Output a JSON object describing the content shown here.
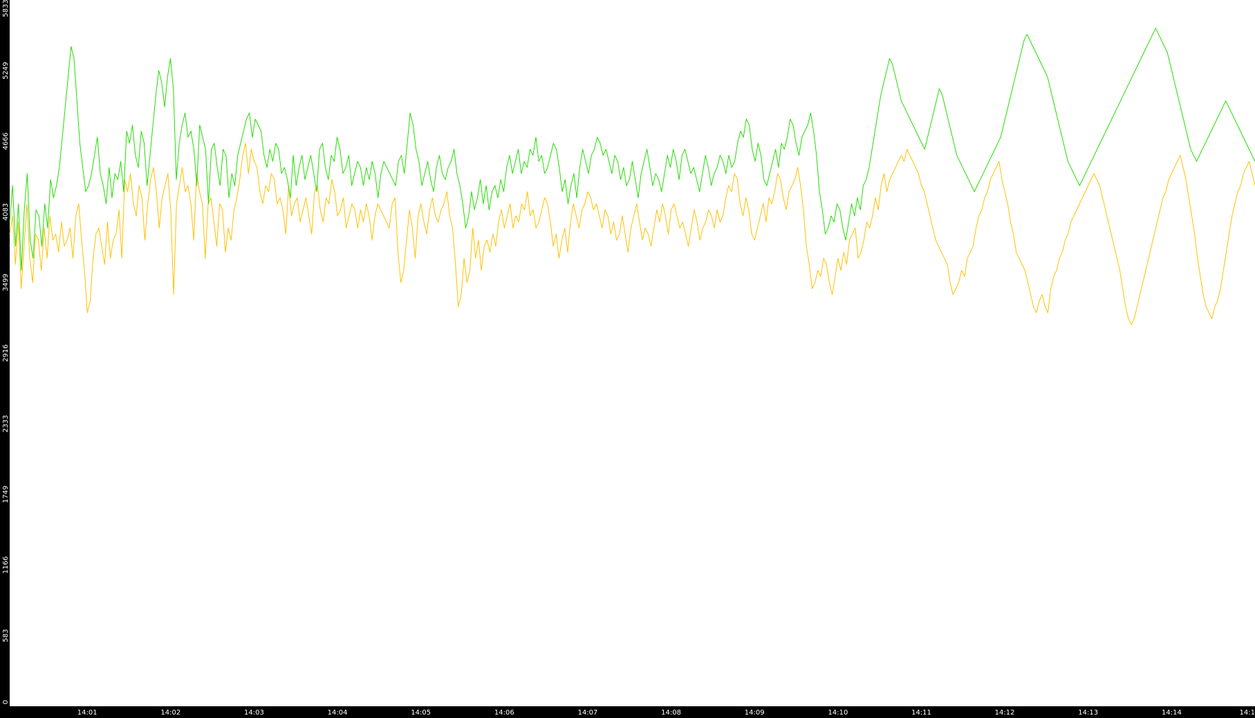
{
  "chart_data": {
    "type": "line",
    "title": "",
    "xlabel": "",
    "ylabel": "",
    "ylim": [
      0,
      5833
    ],
    "y_ticks": [
      "0",
      "583",
      "1166",
      "1749",
      "2333",
      "2916",
      "3499",
      "4083",
      "4666",
      "5249",
      "5833"
    ],
    "x_ticks": [
      "14:01",
      "14:02",
      "14:03",
      "14:04",
      "14:05",
      "14:06",
      "14:07",
      "14:08",
      "14:09",
      "14:10",
      "14:11",
      "14:12",
      "14:13",
      "14:14",
      "14:1"
    ],
    "x_tick_minutes": [
      1,
      2,
      3,
      4,
      5,
      6,
      7,
      8,
      9,
      10,
      11,
      12,
      13,
      14,
      15
    ],
    "x_start_minute": 0.07,
    "x_end_minute": 15.0,
    "grid": false,
    "legend": "none",
    "background": "#ffffff",
    "axis_background": "#000000",
    "axis_text_color": "#ffffff",
    "series": [
      {
        "color": "#ffc000",
        "values": [
          3900,
          4050,
          3650,
          4000,
          3450,
          3800,
          4150,
          3700,
          3500,
          3900,
          3850,
          3600,
          3950,
          3700,
          4050,
          3850,
          3900,
          3750,
          4000,
          3800,
          3850,
          3950,
          3700,
          4050,
          4150,
          3850,
          3600,
          3250,
          3350,
          3700,
          3900,
          3950,
          3800,
          3650,
          4000,
          3700,
          3850,
          3900,
          4100,
          3700,
          4350,
          4250,
          4400,
          4150,
          4050,
          4300,
          4200,
          3850,
          4150,
          4350,
          4450,
          4250,
          3950,
          4200,
          4300,
          4400,
          4100,
          3400,
          4150,
          4300,
          4450,
          4250,
          4300,
          4150,
          3850,
          4400,
          4250,
          4150,
          3700,
          4150,
          4200,
          4000,
          3800,
          4150,
          4100,
          3750,
          3950,
          3850,
          4100,
          4200,
          4350,
          4550,
          4650,
          4400,
          4600,
          4500,
          4450,
          4250,
          4150,
          4300,
          4250,
          4400,
          4350,
          4150,
          4200,
          4100,
          3900,
          4300,
          4050,
          4150,
          4200,
          4000,
          4100,
          4200,
          4050,
          3900,
          4250,
          4300,
          4100,
          4000,
          4200,
          4150,
          4350,
          4250,
          4050,
          4100,
          4200,
          3950,
          4050,
          4150,
          4100,
          3950,
          4100,
          4000,
          4150,
          4050,
          3850,
          4050,
          4150,
          4100,
          4050,
          4000,
          3950,
          4150,
          4200,
          3750,
          3500,
          3600,
          3850,
          4100,
          3950,
          3700,
          4050,
          4150,
          4000,
          3900,
          4100,
          4200,
          4050,
          4000,
          4100,
          4150,
          4250,
          4050,
          3950,
          3650,
          3300,
          3400,
          3700,
          3500,
          3600,
          3950,
          3700,
          3850,
          3600,
          3800,
          3850,
          3750,
          3900,
          3800,
          4000,
          4100,
          3950,
          4050,
          4150,
          3950,
          4050,
          4000,
          4150,
          4100,
          4250,
          4050,
          4100,
          3950,
          4000,
          4100,
          4200,
          4150,
          4000,
          3800,
          3900,
          3700,
          3850,
          3950,
          3750,
          4000,
          4150,
          4050,
          3950,
          4100,
          4150,
          4250,
          4200,
          4100,
          4150,
          4050,
          3950,
          4100,
          4050,
          3900,
          4000,
          3850,
          3900,
          4050,
          3900,
          3750,
          3950,
          4050,
          4150,
          4000,
          3850,
          3950,
          3900,
          3800,
          3950,
          4100,
          4000,
          4150,
          4050,
          3900,
          4100,
          4150,
          4050,
          3950,
          4000,
          3900,
          3800,
          3950,
          4100,
          4000,
          3850,
          3950,
          4000,
          4100,
          4050,
          3950,
          4100,
          4000,
          4050,
          4200,
          4300,
          4250,
          4400,
          4350,
          4150,
          4050,
          4200,
          4100,
          3900,
          3850,
          3950,
          4050,
          4150,
          4000,
          4200,
          4150,
          4250,
          4400,
          4350,
          4200,
          4100,
          4250,
          4300,
          4350,
          4450,
          4300,
          4100,
          3800,
          3650,
          3450,
          3500,
          3600,
          3550,
          3700,
          3650,
          3500,
          3400,
          3550,
          3700,
          3600,
          3750,
          3650,
          3850,
          3900,
          3950,
          3700,
          3750,
          3850,
          4000,
          3950,
          4050,
          4200,
          4100,
          4300,
          4400,
          4250,
          4350,
          4400,
          4450,
          4500,
          4550,
          4500,
          4600,
          4550,
          4500,
          4450,
          4400,
          4300,
          4250,
          4150,
          4050,
          3950,
          3850,
          3800,
          3750,
          3700,
          3650,
          3500,
          3400,
          3450,
          3500,
          3600,
          3550,
          3700,
          3750,
          3800,
          3950,
          4050,
          4100,
          4200,
          4250,
          4350,
          4400,
          4450,
          4500,
          4350,
          4250,
          4150,
          4000,
          3900,
          3750,
          3700,
          3650,
          3600,
          3500,
          3400,
          3300,
          3250,
          3350,
          3400,
          3300,
          3250,
          3450,
          3550,
          3600,
          3700,
          3750,
          3850,
          3900,
          4000,
          4050,
          4100,
          4150,
          4200,
          4250,
          4300,
          4350,
          4400,
          4350,
          4300,
          4200,
          4100,
          4000,
          3900,
          3800,
          3700,
          3600,
          3450,
          3300,
          3200,
          3150,
          3200,
          3300,
          3400,
          3500,
          3600,
          3700,
          3800,
          3900,
          4000,
          4100,
          4200,
          4250,
          4350,
          4400,
          4450,
          4500,
          4550,
          4450,
          4350,
          4200,
          4050,
          3900,
          3700,
          3550,
          3400,
          3300,
          3250,
          3200,
          3300,
          3350,
          3450,
          3600,
          3750,
          3900,
          4050,
          4150,
          4250,
          4300,
          4400,
          4450,
          4500,
          4400,
          4300
        ]
      },
      {
        "color": "#22dd00",
        "values": [
          4000,
          4300,
          3800,
          4150,
          3600,
          4100,
          4400,
          3850,
          3700,
          4100,
          4050,
          3800,
          4150,
          3950,
          4350,
          4200,
          4300,
          4450,
          4700,
          4950,
          5200,
          5450,
          5350,
          5000,
          4650,
          4450,
          4250,
          4300,
          4400,
          4550,
          4700,
          4400,
          4300,
          4150,
          4450,
          4200,
          4400,
          4350,
          4500,
          4250,
          4750,
          4650,
          4800,
          4550,
          4450,
          4750,
          4650,
          4300,
          4550,
          4800,
          5050,
          5250,
          5150,
          4950,
          5200,
          5350,
          5100,
          4350,
          4650,
          4800,
          4900,
          4700,
          4750,
          4600,
          4300,
          4800,
          4700,
          4600,
          4150,
          4600,
          4650,
          4450,
          4300,
          4600,
          4550,
          4200,
          4400,
          4300,
          4550,
          4650,
          4750,
          4850,
          4900,
          4700,
          4850,
          4800,
          4750,
          4550,
          4450,
          4600,
          4500,
          4650,
          4600,
          4400,
          4450,
          4350,
          4200,
          4550,
          4300,
          4450,
          4550,
          4350,
          4450,
          4550,
          4400,
          4250,
          4600,
          4650,
          4450,
          4350,
          4550,
          4500,
          4700,
          4600,
          4400,
          4450,
          4550,
          4300,
          4400,
          4500,
          4450,
          4300,
          4450,
          4350,
          4500,
          4400,
          4200,
          4400,
          4500,
          4450,
          4400,
          4350,
          4300,
          4500,
          4550,
          4400,
          4650,
          4900,
          4800,
          4600,
          4500,
          4300,
          4400,
          4500,
          4350,
          4250,
          4450,
          4550,
          4400,
          4350,
          4450,
          4500,
          4600,
          4400,
          4300,
          4150,
          3950,
          4050,
          4250,
          4100,
          4200,
          4350,
          4150,
          4300,
          4100,
          4250,
          4300,
          4200,
          4350,
          4250,
          4450,
          4550,
          4400,
          4500,
          4600,
          4400,
          4500,
          4450,
          4600,
          4550,
          4700,
          4500,
          4550,
          4400,
          4450,
          4550,
          4650,
          4600,
          4450,
          4250,
          4350,
          4150,
          4300,
          4400,
          4200,
          4450,
          4600,
          4500,
          4400,
          4550,
          4600,
          4700,
          4650,
          4550,
          4600,
          4500,
          4400,
          4550,
          4500,
          4350,
          4450,
          4300,
          4350,
          4500,
          4350,
          4200,
          4400,
          4500,
          4600,
          4450,
          4300,
          4400,
          4350,
          4250,
          4400,
          4550,
          4450,
          4600,
          4500,
          4350,
          4550,
          4600,
          4500,
          4400,
          4450,
          4350,
          4250,
          4400,
          4550,
          4450,
          4300,
          4400,
          4450,
          4550,
          4500,
          4400,
          4550,
          4450,
          4500,
          4650,
          4750,
          4700,
          4850,
          4800,
          4600,
          4500,
          4650,
          4550,
          4350,
          4300,
          4400,
          4500,
          4600,
          4450,
          4650,
          4600,
          4700,
          4850,
          4800,
          4650,
          4550,
          4700,
          4750,
          4800,
          4900,
          4750,
          4550,
          4250,
          4100,
          3900,
          3950,
          4050,
          4000,
          4150,
          4100,
          3950,
          3850,
          4000,
          4150,
          4050,
          4200,
          4100,
          4300,
          4350,
          4450,
          4600,
          4750,
          4900,
          5050,
          5150,
          5250,
          5350,
          5300,
          5200,
          5100,
          5000,
          4950,
          4900,
          4850,
          4800,
          4750,
          4700,
          4650,
          4600,
          4700,
          4800,
          4900,
          5000,
          5100,
          5050,
          4950,
          4850,
          4750,
          4650,
          4550,
          4500,
          4450,
          4400,
          4350,
          4300,
          4250,
          4300,
          4350,
          4400,
          4450,
          4500,
          4550,
          4600,
          4650,
          4700,
          4800,
          4900,
          5000,
          5100,
          5200,
          5300,
          5400,
          5500,
          5550,
          5500,
          5450,
          5400,
          5350,
          5300,
          5250,
          5200,
          5100,
          5000,
          4900,
          4800,
          4700,
          4600,
          4500,
          4450,
          4400,
          4350,
          4300,
          4350,
          4400,
          4450,
          4500,
          4550,
          4600,
          4650,
          4700,
          4750,
          4800,
          4850,
          4900,
          4950,
          5000,
          5050,
          5100,
          5150,
          5200,
          5250,
          5300,
          5350,
          5400,
          5450,
          5500,
          5550,
          5600,
          5550,
          5500,
          5450,
          5400,
          5300,
          5200,
          5100,
          5000,
          4900,
          4800,
          4700,
          4600,
          4550,
          4500,
          4550,
          4600,
          4650,
          4700,
          4750,
          4800,
          4850,
          4900,
          4950,
          5000,
          4950,
          4900,
          4850,
          4800,
          4750,
          4700,
          4650,
          4600,
          4550,
          4500
        ]
      }
    ]
  }
}
